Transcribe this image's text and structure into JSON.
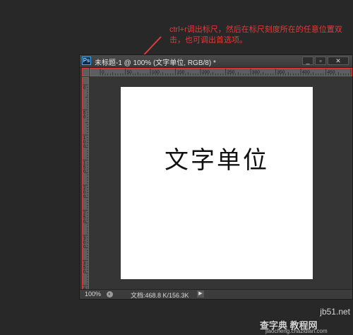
{
  "annotation": {
    "text": "ctrl+r调出标尺，然后在标尺刻度所在的任意位置双击，也可调出首选项。",
    "color": "#e23b3b"
  },
  "window": {
    "app_icon": "Ps",
    "title": "未标题-1 @ 100% (文字单位, RGB/8) *",
    "buttons": {
      "minimize": "_",
      "restore": "▫",
      "close": "✕"
    }
  },
  "rulers": {
    "h_ticks": [
      "0",
      "50",
      "100",
      "150",
      "200",
      "250",
      "300",
      "350",
      "400",
      "450",
      "50"
    ],
    "v_ticks": [
      "0",
      "5\n0",
      "1\n0\n0",
      "1\n5\n0",
      "2\n0\n0",
      "2\n5\n0",
      "3\n0\n0",
      "3\n5\n0",
      "4\n0\n0"
    ]
  },
  "canvas": {
    "text": "文字单位"
  },
  "status": {
    "zoom": "100%",
    "doc_info": "文档:468.8 K/156.3K",
    "arrow": "▶"
  },
  "watermark": {
    "line1": "jb51.net",
    "line2": "查字典 教程网",
    "line3": "jiaocheng.chazidian.com"
  }
}
